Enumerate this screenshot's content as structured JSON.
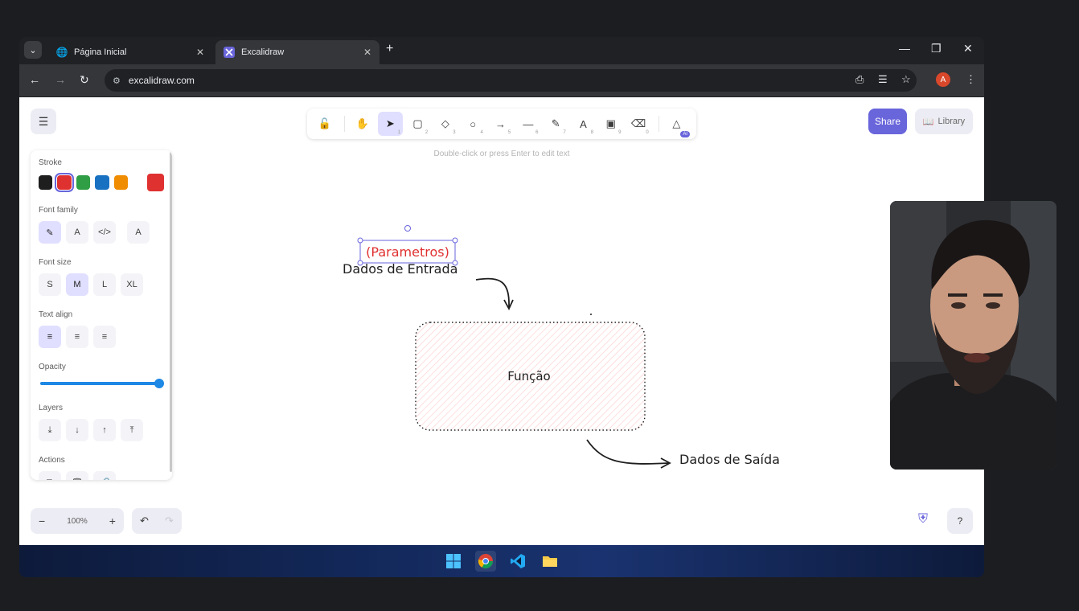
{
  "browser": {
    "tabs": [
      {
        "title": "Página Inicial",
        "active": false
      },
      {
        "title": "Excalidraw",
        "active": true
      }
    ],
    "url": "excalidraw.com",
    "profile_initial": "A"
  },
  "excalidraw": {
    "tools": [
      {
        "name": "lock",
        "key": ""
      },
      {
        "name": "hand",
        "key": ""
      },
      {
        "name": "selection",
        "key": "1"
      },
      {
        "name": "rectangle",
        "key": "2"
      },
      {
        "name": "diamond",
        "key": "3"
      },
      {
        "name": "ellipse",
        "key": "4"
      },
      {
        "name": "arrow",
        "key": "5"
      },
      {
        "name": "line",
        "key": "6"
      },
      {
        "name": "draw",
        "key": "7"
      },
      {
        "name": "text",
        "key": "8"
      },
      {
        "name": "image",
        "key": "9"
      },
      {
        "name": "eraser",
        "key": "0"
      }
    ],
    "ai_badge": "AI",
    "hint": "Double-click or press Enter to edit text",
    "share_label": "Share",
    "library_label": "Library",
    "properties": {
      "stroke_label": "Stroke",
      "stroke_colors": [
        "#1e1e1e",
        "#e03131",
        "#2f9e44",
        "#1971c2",
        "#f08c00"
      ],
      "current_color": "#e03131",
      "font_family_label": "Font family",
      "font_size_label": "Font size",
      "font_sizes": [
        "S",
        "M",
        "L",
        "XL"
      ],
      "font_size_selected": "M",
      "text_align_label": "Text align",
      "opacity_label": "Opacity",
      "opacity": 1.0,
      "layers_label": "Layers",
      "actions_label": "Actions"
    },
    "zoom": "100%",
    "canvas": {
      "selected_text": "(Parametros)",
      "input_text": "Dados de Entrada",
      "function_text": "Função",
      "output_text": "Dados de Saída"
    }
  },
  "colors": {
    "accent": "#6965db",
    "selected_tool_bg": "#e0dfff",
    "red_text": "#e03131",
    "fill_hatch": "#ffc9c9"
  }
}
